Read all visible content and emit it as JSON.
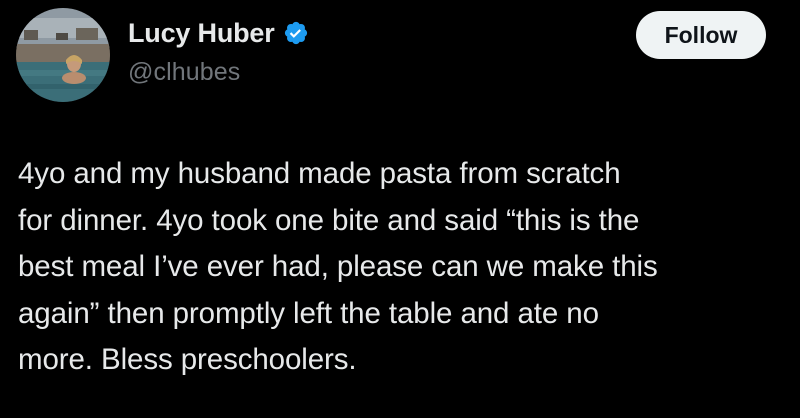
{
  "author": {
    "display_name": "Lucy Huber",
    "handle": "@clhubes",
    "verified": true,
    "verified_color": "#1d9bf0"
  },
  "actions": {
    "follow_label": "Follow"
  },
  "tweet": {
    "lines": [
      "4yo and my husband made pasta from scratch",
      "for dinner. 4yo took one bite and said “this is the",
      "best meal I’ve ever had, please can we make this",
      "again” then promptly left the table and ate no",
      "more. Bless preschoolers."
    ]
  },
  "colors": {
    "background": "#000000",
    "text_primary": "#e7e9ea",
    "text_secondary": "#71767b",
    "follow_bg": "#eff3f4",
    "follow_text": "#0f1419"
  }
}
